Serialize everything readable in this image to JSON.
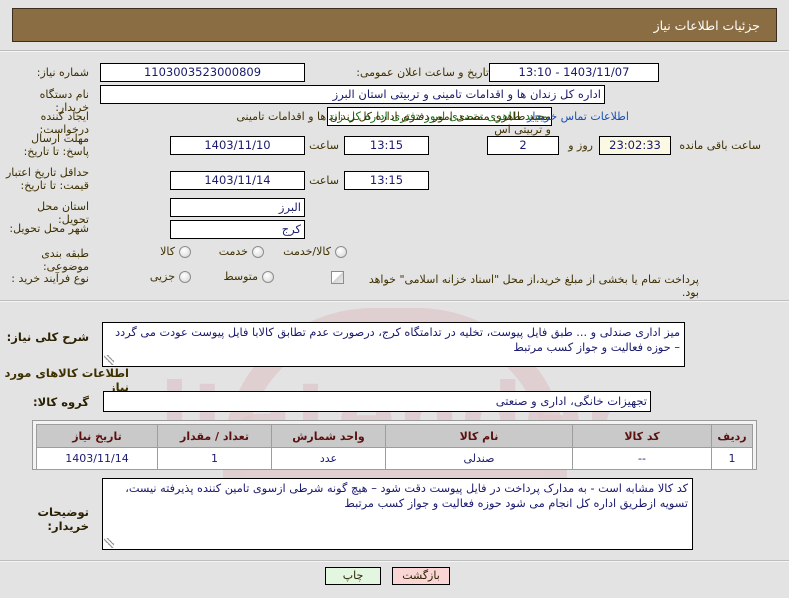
{
  "header": {
    "title": "جزئیات اطلاعات نیاز"
  },
  "form": {
    "need_number_label": "شماره نیاز:",
    "need_number_value": "1103003523000809",
    "announce_label": "تاریخ و ساعت اعلان عمومی:",
    "announce_value": "1403/11/07 - 13:10",
    "buyer_org_label": "نام دستگاه خریدار:",
    "buyer_org_value": "اداره کل زندان ها و اقدامات تامینی و تربیتی استان البرز",
    "creator_label": "ایجاد کننده درخواست:",
    "creator_value": "مجید طاهری متصدی امور دفتری اداره کل زندان ها و اقدامات تامینی و تربیتی اس",
    "contact_link": "اطلاعات تماس خریدار",
    "deadline_label": "مهلت ارسال پاسخ: تا تاریخ:",
    "deadline_date": "1403/11/10",
    "hour_label": "ساعت",
    "deadline_time": "13:15",
    "remaining_days": "2",
    "days_and_label": "روز و",
    "remaining_time": "23:02:33",
    "remaining_suffix": "ساعت باقی مانده",
    "price_validity_label": "حداقل تاریخ اعتبار قیمت: تا تاریخ:",
    "price_validity_date": "1403/11/14",
    "price_validity_time": "13:15",
    "province_label": "استان محل تحویل:",
    "province_value": "البرز",
    "city_label": "شهر محل تحویل:",
    "city_value": "کرج",
    "category_label": "طبقه بندی موضوعی:",
    "category_options": [
      "کالا",
      "خدمت",
      "کالا/خدمت"
    ],
    "process_label": "نوع فرآیند خرید :",
    "process_options": [
      "جزیی",
      "متوسط"
    ],
    "treasury_checkbox_label": "پرداخت تمام یا بخشی از مبلغ خرید،از محل \"اسناد خزانه اسلامی\" خواهد بود."
  },
  "description": {
    "label": "شرح کلی نیاز:",
    "value": "میز اداری صندلی و ... طبق فایل پیوست، تخلیه در تدامتگاه کرج، درصورت عدم تطابق کالابا فایل پیوست عودت می گردد – حوزه فعالیت و جواز کسب مرتبط"
  },
  "goods_section": {
    "title": "اطلاعات کالاهای مورد نیاز",
    "group_label": "گروه کالا:",
    "group_value": "تجهیزات خانگی، اداری و صنعتی"
  },
  "table": {
    "columns": [
      "ردیف",
      "کد کالا",
      "نام کالا",
      "واحد شمارش",
      "تعداد / مقدار",
      "تاریخ نیاز"
    ],
    "rows": [
      [
        "1",
        "--",
        "صندلی",
        "عدد",
        "1",
        "1403/11/14"
      ]
    ]
  },
  "notes": {
    "label": "توضیحات خریدار:",
    "value": "کد کالا مشابه است - به مدارک پرداخت در فایل پیوست دقت شود – هیچ گونه شرطی ازسوی تامین کننده پذیرفته نیست، تسویه ازطریق اداره کل انجام می شود حوزه فعالیت و جواز کسب مرتبط"
  },
  "buttons": {
    "print": "چاپ",
    "back": "بازگشت"
  },
  "watermark": {
    "text": "itatender"
  },
  "colors": {
    "header_bg": "#8a6d42",
    "page_bg": "#e3e3e3",
    "label": "#3f3000",
    "value": "#1a1a6e",
    "link": "#1b4fb5",
    "table_header_bg": "#c9c9c9",
    "table_header_text": "#5c1010",
    "print_btn": "#e3f7e0",
    "back_btn": "#f9d5d5"
  }
}
